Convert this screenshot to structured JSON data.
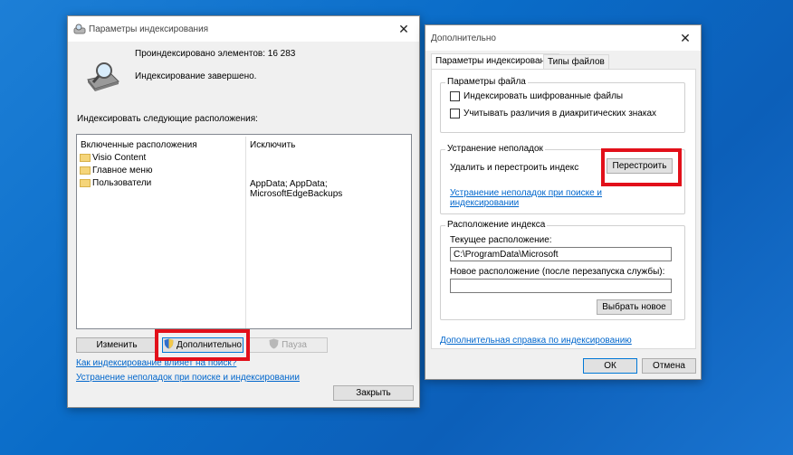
{
  "window1": {
    "title": "Параметры индексирования",
    "indexed_count": "Проиндексировано элементов: 16 283",
    "status": "Индексирование завершено.",
    "locations_label": "Индексировать следующие расположения:",
    "columns": {
      "included": "Включенные расположения",
      "excluded": "Исключить"
    },
    "rows": [
      {
        "name": "Visio Content",
        "exclude": ""
      },
      {
        "name": "Главное меню",
        "exclude": ""
      },
      {
        "name": "Пользователи",
        "exclude": "AppData; AppData; MicrosoftEdgeBackups"
      }
    ],
    "buttons": {
      "modify": "Изменить",
      "advanced": "Дополнительно",
      "pause": "Пауза",
      "close": "Закрыть"
    },
    "links": {
      "how_affects": "Как индексирование влияет на поиск?",
      "troubleshoot": "Устранение неполадок при поиске и индексировании"
    }
  },
  "window2": {
    "title": "Дополнительно",
    "tabs": [
      "Параметры индексирования",
      "Типы файлов"
    ],
    "file_settings": {
      "label": "Параметры файла",
      "encrypt": "Индексировать шифрованные файлы",
      "diacritics": "Учитывать различия в диакритических знаках"
    },
    "troubleshooting": {
      "label": "Устранение неполадок",
      "rebuild_text": "Удалить и перестроить индекс",
      "rebuild_button": "Перестроить",
      "link_line1": "Устранение неполадок при поиске и",
      "link_line2": "индексировании"
    },
    "index_location": {
      "label": "Расположение индекса",
      "current_label": "Текущее расположение:",
      "current_value": "C:\\ProgramData\\Microsoft",
      "new_label": "Новое расположение (после перезапуска службы):",
      "new_value": "",
      "select_button": "Выбрать новое"
    },
    "help_link": "Дополнительная справка по индексированию",
    "ok": "ОК",
    "cancel": "Отмена"
  },
  "icons": [
    "close-icon",
    "search-icon",
    "drive-icon",
    "shield-icon",
    "folder-icon",
    "indexing-options-icon",
    "pause-icon"
  ]
}
